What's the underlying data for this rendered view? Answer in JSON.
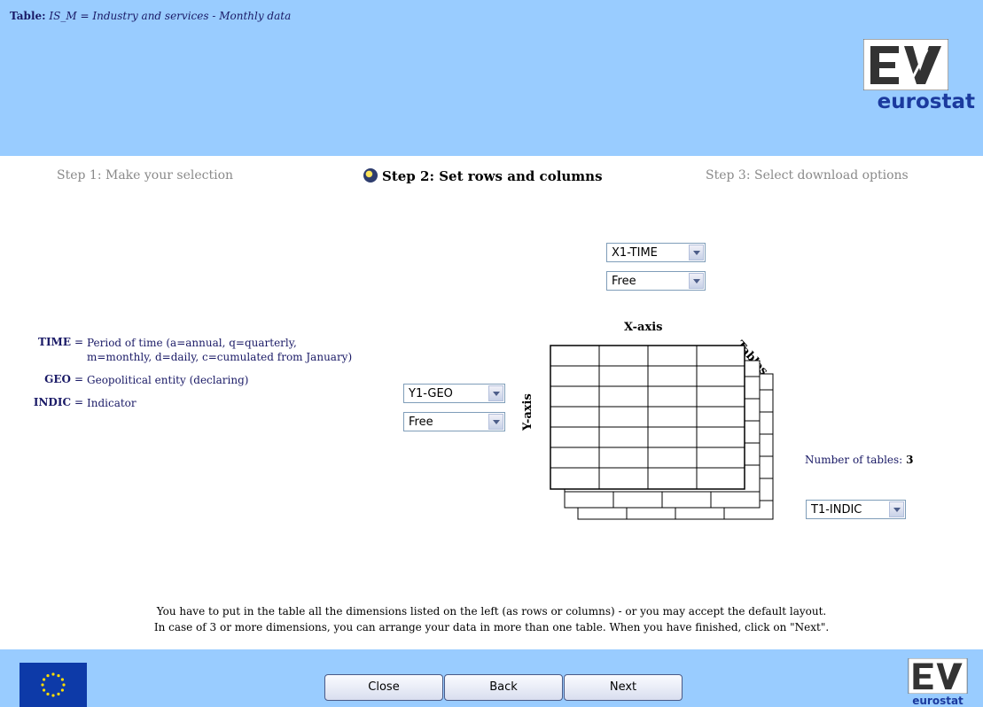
{
  "header": {
    "table_prefix": "Table:",
    "table_name": "IS_M",
    "table_description": "= Industry and services - Monthly data",
    "logo_text": "eurostat"
  },
  "steps": {
    "step1": "Step 1: Make your selection",
    "step2": "Step 2: Set rows and columns",
    "step3": "Step 3: Select download options"
  },
  "legend": [
    {
      "key": "TIME",
      "desc": "Period of time (a=annual, q=quarterly, m=monthly, d=daily, c=cumulated from January)"
    },
    {
      "key": "GEO",
      "desc": "Geopolitical entity (declaring)"
    },
    {
      "key": "INDIC",
      "desc": "Indicator"
    }
  ],
  "selects": {
    "x1_dim": "X1-TIME",
    "x1_sort": "Free",
    "y1_dim": "Y1-GEO",
    "y1_sort": "Free",
    "t1_dim": "T1-INDIC"
  },
  "layout_graphic": {
    "x_axis": "X-axis",
    "y_axis": "Y-axis",
    "tables": "Tables"
  },
  "number_of_tables_label": "Number of tables:",
  "number_of_tables": "3",
  "instructions": [
    "You have to put in the table all the dimensions listed on the left (as rows or columns) - or you may accept the default layout.",
    "In case of 3 or more dimensions, you can arrange your data in more than one table. When you have finished, click on \"Next\"."
  ],
  "footer": {
    "close_label": "Close",
    "back_label": "Back",
    "next_label": "Next",
    "logo_text": "eurostat"
  }
}
